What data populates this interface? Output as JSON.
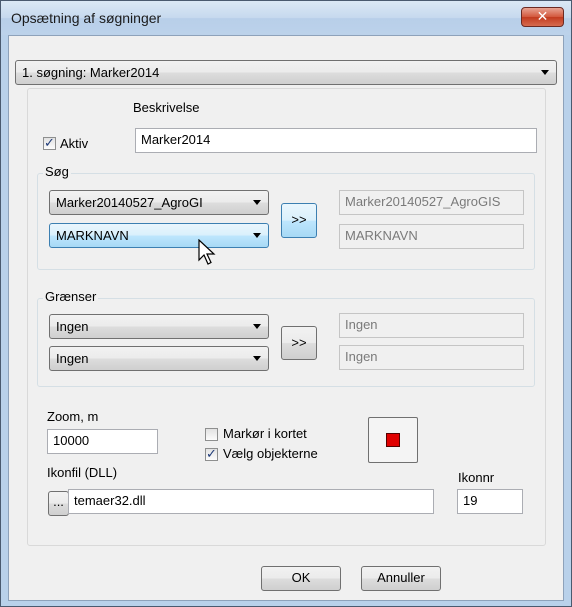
{
  "window": {
    "title": "Opsætning af søgninger",
    "close_glyph": "✕"
  },
  "search_select": {
    "value": "1. søgning: Marker2014"
  },
  "search": {
    "description_label": "Beskrivelse",
    "description_value": "Marker2014",
    "active_label": "Aktiv",
    "active_checked": true,
    "group_label": "Søg",
    "layer_combo": "Marker20140527_AgroGI",
    "field_combo": "MARKNAVN",
    "transfer_label": ">>",
    "layer_result": "Marker20140527_AgroGIS",
    "field_result": "MARKNAVN"
  },
  "limits": {
    "group_label": "Grænser",
    "combo1": "Ingen",
    "combo2": "Ingen",
    "transfer_label": ">>",
    "result1": "Ingen",
    "result2": "Ingen"
  },
  "options": {
    "zoom_label": "Zoom, m",
    "zoom_value": "10000",
    "marker_label": "Markør i kortet",
    "marker_checked": false,
    "select_objects_label": "Vælg objekterne",
    "select_objects_checked": true,
    "marker_color": "#e00000",
    "icon_file_label": "Ikonfil (DLL)",
    "browse_label": "...",
    "icon_file_value": "temaer32.dll",
    "icon_nr_label": "Ikonnr",
    "icon_nr_value": "19"
  },
  "footer": {
    "ok_label": "OK",
    "cancel_label": "Annuller"
  }
}
